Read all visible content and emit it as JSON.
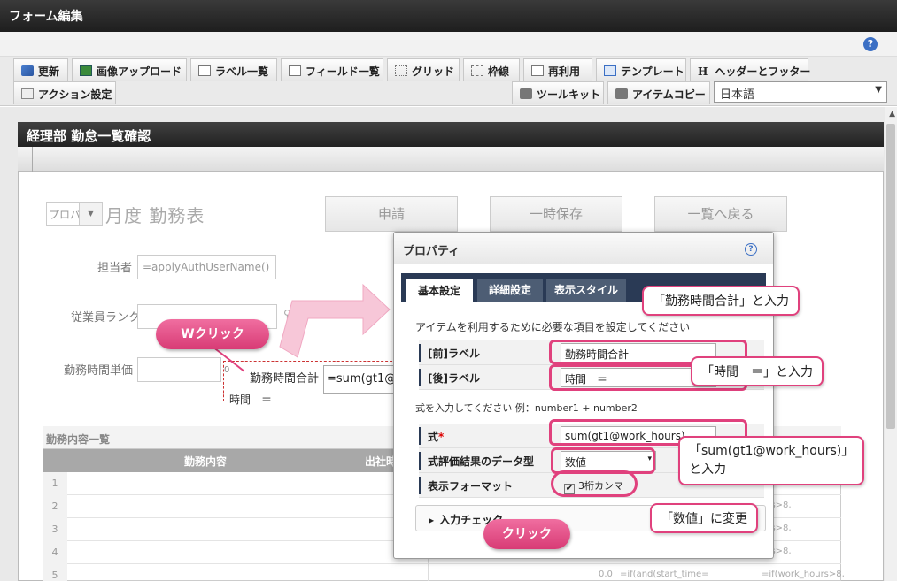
{
  "window": {
    "title": "フォーム編集",
    "help": "?"
  },
  "toolbar": {
    "row1": [
      {
        "key": "update",
        "label": "更新"
      },
      {
        "key": "upload",
        "label": "画像アップロード"
      },
      {
        "key": "labels",
        "label": "ラベル一覧"
      },
      {
        "key": "fields",
        "label": "フィールド一覧"
      },
      {
        "key": "grid",
        "label": "グリッド"
      },
      {
        "key": "frame",
        "label": "枠線"
      },
      {
        "key": "reuse",
        "label": "再利用"
      },
      {
        "key": "template",
        "label": "テンプレート"
      },
      {
        "key": "headerfooter",
        "label": "ヘッダーとフッター"
      }
    ],
    "row2": [
      {
        "key": "action",
        "label": "アクション設定"
      },
      {
        "key": "toolkit",
        "label": "ツールキット"
      },
      {
        "key": "itemcopy",
        "label": "アイテムコピー"
      }
    ],
    "language": "日本語",
    "header_icon_letter": "H"
  },
  "form": {
    "header": "経理部 勤怠一覧確認",
    "select_placeholder": "プロパ",
    "month_title": "月度 勤務表",
    "buttons": {
      "apply": "申請",
      "save": "一時保存",
      "back": "一覧へ戻る"
    },
    "fields": {
      "owner_label": "担当者",
      "owner_value": "=applyAuthUserName()",
      "rank_label": "従業員ランク",
      "unit_label": "勤務時間単価"
    },
    "selected_item": {
      "label_before": "勤務時間合計",
      "input_value": "=sum(gt1@work_hours)",
      "label_after": "時間　＝",
      "zero": "0"
    },
    "table": {
      "title": "勤務内容一覧",
      "columns": [
        "勤務内容",
        "出社時"
      ],
      "rows": [
        "1",
        "2",
        "3",
        "4",
        "5"
      ],
      "tail_text": "urs>8,",
      "row5_left": "0.0",
      "row5_mid": "=if(and(start_time=",
      "row5_right": "=if(work_hours>8,"
    }
  },
  "dialog": {
    "title": "プロパティ",
    "help": "?",
    "tabs": [
      "基本設定",
      "詳細設定",
      "表示スタイル"
    ],
    "description": "アイテムを利用するために必要な項目を設定してください",
    "props": {
      "label_before": {
        "label": "[前]ラベル",
        "value": "勤務時間合計"
      },
      "label_after": {
        "label": "[後]ラベル",
        "value": "時間　＝"
      },
      "formula_hint": "式を入力してください 例：number1 + number2",
      "formula": {
        "label": "式",
        "required": "*",
        "value": "sum(gt1@work_hours)"
      },
      "datatype": {
        "label": "式評価結果のデータ型",
        "value": "数値"
      },
      "format": {
        "label": "表示フォーマット",
        "checkbox": "3桁カンマ",
        "checked": "✔"
      }
    },
    "input_check": "入力チェック"
  },
  "annotations": {
    "double_click": "Wクリック",
    "click": "クリック",
    "callout_total": "「勤務時間合計」と入力",
    "callout_hours": "「時間　＝」と入力",
    "callout_sum_line1": "「sum(gt1@work_hours)」",
    "callout_sum_line2": "と入力",
    "callout_number": "「数値」に変更"
  },
  "colors": {
    "highlight": "#e0417d",
    "tab_bar": "#2a3a55",
    "titlebar": "#2a2a2a"
  }
}
